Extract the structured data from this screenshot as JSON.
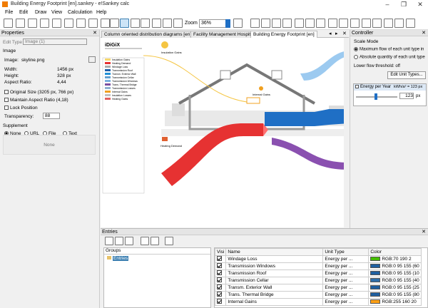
{
  "window": {
    "title": "Building Energy Footprint [en].sankey - e!Sankey calc"
  },
  "menu": [
    "File",
    "Edit",
    "Draw",
    "View",
    "Calculation",
    "Help"
  ],
  "toolbar": {
    "zoom_label": "Zoom",
    "zoom_value": "36%"
  },
  "properties": {
    "title": "Properties",
    "edit_type_label": "Edit Type",
    "edit_type_value": "Image (1)",
    "section_image": "Image",
    "image_label": "Image:",
    "image_value": "skyline.png",
    "width_label": "Width:",
    "width_value": "1456 px",
    "height_label": "Height:",
    "height_value": "328 px",
    "aspect_label": "Aspect Ratio:",
    "aspect_value": "4,44",
    "original_size": "Original Size (3205 px, 766 px)",
    "maintain_aspect": "Maintain Aspect Ratio (4,18)",
    "lock_position": "Lock Position",
    "transparency_label": "Transparency:",
    "transparency_value": "88",
    "supplement_label": "Supplement",
    "supplement_options": [
      "None",
      "URL",
      "File",
      "Text"
    ],
    "supplement_none": "None"
  },
  "doc_tabs": [
    "Column oriented distribution diagrams [en]",
    "Facility Management Hospital [en]",
    "Building Energy Footprint [en]"
  ],
  "diagram": {
    "logo": "iDiGiX",
    "legend_items": [
      {
        "label": "Insulation Gains",
        "color": "#f5d76e"
      },
      {
        "label": "Heating Demand",
        "color": "#e63232"
      },
      {
        "label": "Windage Loss",
        "color": "#aaaaaa"
      },
      {
        "label": "Transmission Roof",
        "color": "#1f5fa8"
      },
      {
        "label": "Transm. Exterior Wall",
        "color": "#1f8fd6"
      },
      {
        "label": "Transmission Cellar",
        "color": "#5f9fd0"
      },
      {
        "label": "Transmission Windows",
        "color": "#7ab0e0"
      },
      {
        "label": "Trans. Thermal Bridge",
        "color": "#7a4fa0"
      },
      {
        "label": "Transmission Losses",
        "color": "#8fb0d0"
      },
      {
        "label": "Internal Gains",
        "color": "#f0a020"
      },
      {
        "label": "Insulation Losses",
        "color": "#c0c0c0"
      },
      {
        "label": "Heating Gains",
        "color": "#e06060"
      }
    ],
    "insulation_label": "Insulation Gains",
    "internal_label": "Internal Gains",
    "heating_label": "Heating Demand"
  },
  "controller": {
    "title": "Controller",
    "scale_mode": "Scale Mode",
    "opt_max": "Maximum flow of each unit type in",
    "opt_abs": "Absolute quantity of each unit type",
    "threshold": "Lower flow threshold: off",
    "edit_unit_types": "Edit Unit Types...",
    "energy_label": "Energy per Year",
    "energy_unit": "kWh/a² = 123 px",
    "energy_px": "123",
    "px_label": "px"
  },
  "entries": {
    "title": "Entries",
    "groups_header": "Groups",
    "groups_root": "Entries",
    "columns": [
      "Visi",
      "Name",
      "Unit Type",
      "Color"
    ],
    "rows": [
      {
        "name": "Windage Loss",
        "unit": "Energy per ...",
        "color_text": "RGB:70  190 2",
        "hex": "#46be02"
      },
      {
        "name": "Transmission Windows",
        "unit": "Energy per ...",
        "color_text": "RGB:0  95  155 (60",
        "hex": "#1f5fa0"
      },
      {
        "name": "Transmission Roof",
        "unit": "Energy per ...",
        "color_text": "RGB:0  95  155 (10",
        "hex": "#1f5fa0"
      },
      {
        "name": "Transmission Cellar",
        "unit": "Energy per ...",
        "color_text": "RGB:0  95  155 (40",
        "hex": "#2f6faa"
      },
      {
        "name": "Transm. Exterior Wall",
        "unit": "Energy per ...",
        "color_text": "RGB:0  95  155 (25",
        "hex": "#1f5fa0"
      },
      {
        "name": "Trans. Thermal Bridge",
        "unit": "Energy per ...",
        "color_text": "RGB:0  95  155 (80",
        "hex": "#1f5fa0"
      },
      {
        "name": "Internal Gains",
        "unit": "Energy per ...",
        "color_text": "RGB:255 160 20",
        "hex": "#ffa014"
      }
    ]
  }
}
